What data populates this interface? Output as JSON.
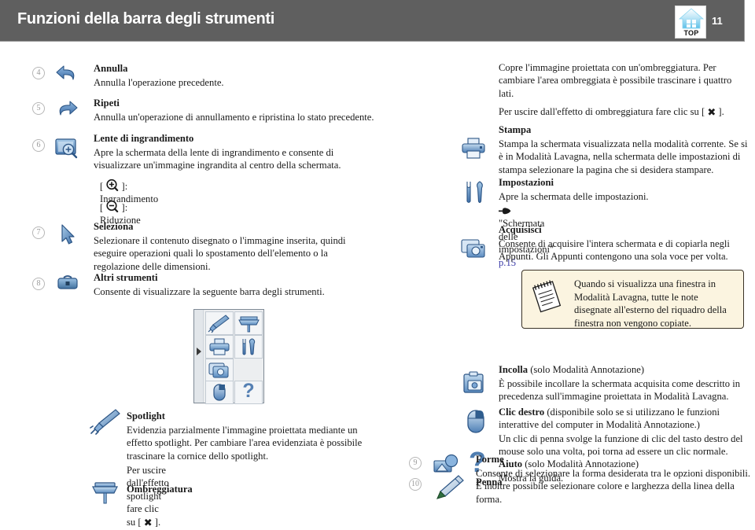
{
  "header": {
    "title": "Funzioni della barra degli strumenti",
    "page_number": "11",
    "logo_label": "TOP",
    "logo_icon": "home-top-icon"
  },
  "left_column": {
    "entries": [
      {
        "number": "4",
        "icon": "undo-arrow-icon",
        "title": "Annulla",
        "body": "Annulla l'operazione precedente."
      },
      {
        "number": "5",
        "icon": "redo-arrow-icon",
        "title": "Ripeti",
        "body": "Annulla un'operazione di annullamento e ripristina lo stato precedente."
      },
      {
        "number": "6",
        "icon": "magnifier-box-icon",
        "title": "Lente di ingrandimento",
        "body": "Apre la schermata della lente di ingrandimento e consente di visualizzare un'immagine ingrandita al centro della schermata.",
        "sub_lines": [
          {
            "icon": "zoom-in-icon",
            "label": "]: Ingrandimento",
            "prefix": "["
          },
          {
            "icon": "zoom-out-icon",
            "label": "]: Riduzione",
            "prefix": "["
          }
        ]
      },
      {
        "number": "7",
        "icon": "cursor-arrow-icon",
        "title": "Seleziona",
        "body": "Selezionare il contenuto disegnato o l'immagine inserita, quindi eseguire operazioni quali lo spostamento dell'elemento o la regolazione delle dimensioni."
      },
      {
        "number": "8",
        "icon": "toolbox-icon",
        "title": "Altri strumenti",
        "body": "Consente di visualizzare la seguente barra degli strumenti."
      }
    ],
    "palette": {
      "name": "other-tools-palette",
      "cells": [
        "spotlight-icon",
        "shade-icon",
        "printer-icon",
        "settings-tools-icon",
        "capture-icon",
        "",
        "mouse-icon",
        "help-question-icon"
      ]
    },
    "spotlight": {
      "icon": "spotlight-icon",
      "title": "Spotlight",
      "body": "Evidenzia parzialmente l'immagine proiettata mediante un effetto spotlight. Per cambiare l'area evidenziata è possibile trascinare la cornice dello spotlight.",
      "exit_prefix": "Per uscire dall'effetto spotlight fare clic su [",
      "exit_suffix": "]."
    },
    "ombreggiatura_title": "Ombreggiatura",
    "ombreggiatura_icon": "shade-icon"
  },
  "right_column": {
    "shade_body": "Copre l'immagine proiettata con un'ombreggiatura. Per cambiare l'area ombreggiata è possibile trascinare i quattro lati.",
    "shade_exit_prefix": "Per uscire dall'effetto di ombreggiatura fare clic su [",
    "shade_exit_suffix": "].",
    "entries": [
      {
        "icon": "printer-icon",
        "title": "Stampa",
        "body": "Stampa la schermata visualizzata nella modalità corrente. Se si è in Modalità Lavagna, nella schermata delle impostazioni di stampa selezionare la pagina che si desidera stampare."
      },
      {
        "icon": "settings-tools-icon",
        "title": "Impostazioni",
        "body": "Apre la schermata delle impostazioni.",
        "reference": {
          "icon": "pointing-hand-icon",
          "text": "\"Schermata delle impostazioni\"",
          "page": "p.15"
        }
      },
      {
        "icon": "capture-icon",
        "title": "Acquisisci",
        "body": "Consente di acquisire l'intera schermata e di copiarla negli Appunti. Gli Appunti contengono una sola voce per volta."
      }
    ],
    "note": {
      "icon": "memo-note-icon",
      "text": "Quando si visualizza una finestra in Modalità Lavagna, tutte le note disegnate all'esterno del riquadro della finestra non vengono copiate."
    },
    "entries2": [
      {
        "icon": "paste-clipboard-icon",
        "title": "Incolla",
        "title_light": " (solo Modalità Annotazione)",
        "body": "È possibile incollare la schermata acquisita come descritto in precedenza sull'immagine proiettata in Modalità Lavagna."
      },
      {
        "icon": "mouse-icon",
        "title": "Clic destro",
        "title_light": " (disponibile solo se si utilizzano le funzioni interattive del computer in Modalità Annotazione.)",
        "body": "Un clic di penna svolge la funzione di clic del tasto destro del mouse solo una volta, poi torna ad essere un clic normale."
      },
      {
        "icon": "help-question-icon",
        "title": "Aiuto",
        "title_light": " (solo Modalità Annotazione)",
        "body": "Mostra la guida."
      }
    ],
    "entries3": [
      {
        "number": "9",
        "icon": "shapes-icon",
        "title": "Forme",
        "body": "Consente di selezionare la forma desiderata tra le opzioni disponibili. È inoltre possibile selezionare colore e larghezza della linea della forma."
      },
      {
        "number": "10",
        "icon": "pen-icon",
        "title": "Penna",
        "body": ""
      }
    ]
  },
  "colors": {
    "header_bg": "#5f5f5f",
    "note_bg": "#fbf4e0",
    "note_border": "#3a3226",
    "icon_blue": "#5b8fc9",
    "link_blue": "#3b3ba8",
    "pen_green": "#2f6e3f"
  }
}
